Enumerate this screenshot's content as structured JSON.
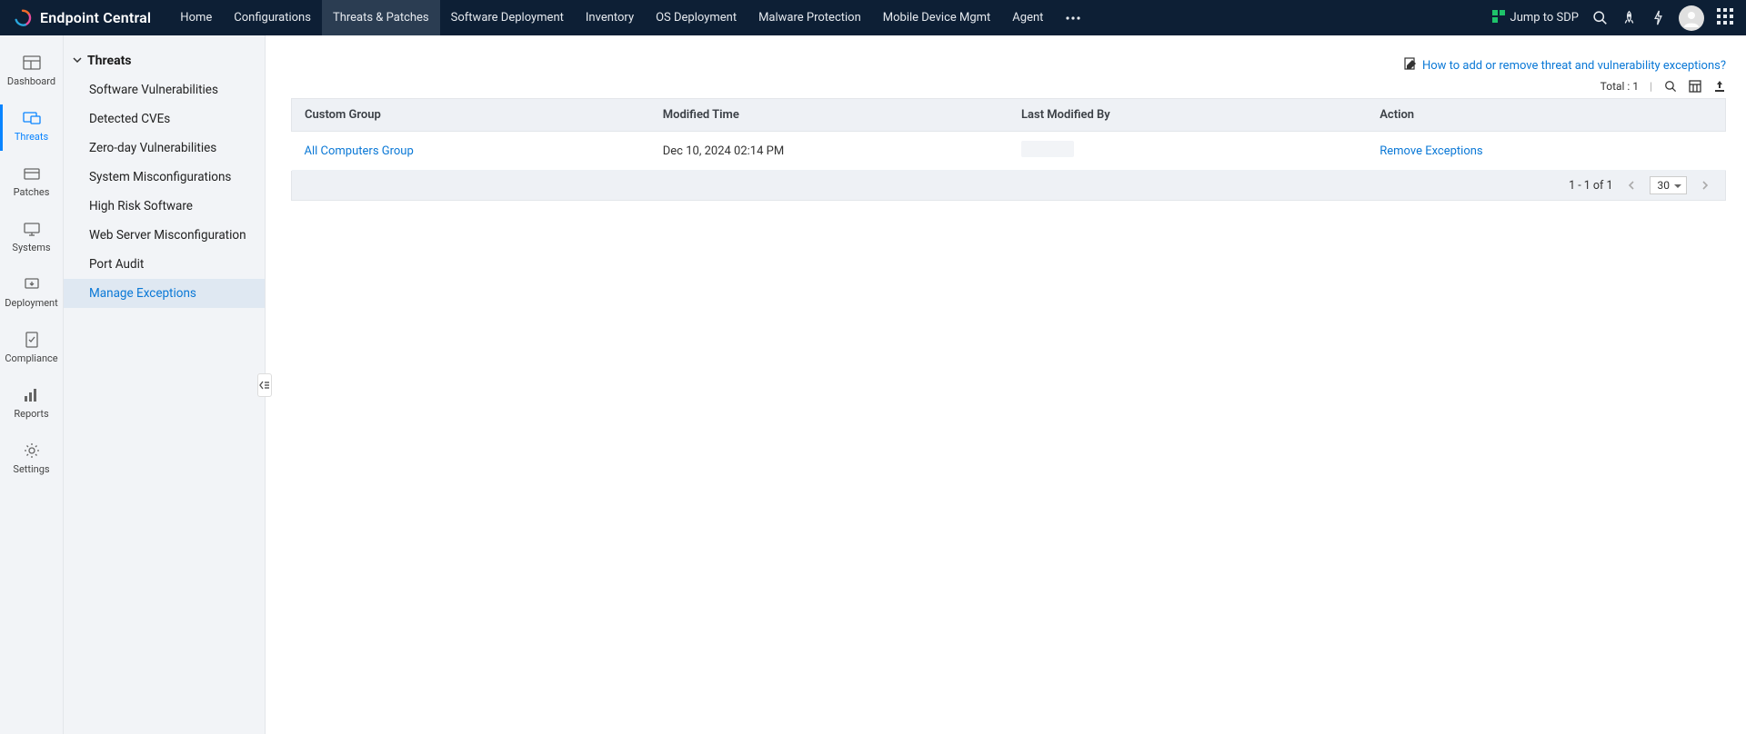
{
  "brand": "Endpoint Central",
  "main_menu": [
    {
      "label": "Home",
      "active": false
    },
    {
      "label": "Configurations",
      "active": false
    },
    {
      "label": "Threats & Patches",
      "active": true
    },
    {
      "label": "Software Deployment",
      "active": false
    },
    {
      "label": "Inventory",
      "active": false
    },
    {
      "label": "OS Deployment",
      "active": false
    },
    {
      "label": "Malware Protection",
      "active": false
    },
    {
      "label": "Mobile Device Mgmt",
      "active": false
    },
    {
      "label": "Agent",
      "active": false
    }
  ],
  "jump_to_sdp": "Jump to SDP",
  "left_rail": [
    {
      "label": "Dashboard",
      "icon": "dashboard",
      "active": false
    },
    {
      "label": "Threats",
      "icon": "threats",
      "active": true
    },
    {
      "label": "Patches",
      "icon": "patches",
      "active": false
    },
    {
      "label": "Systems",
      "icon": "systems",
      "active": false
    },
    {
      "label": "Deployment",
      "icon": "deployment",
      "active": false
    },
    {
      "label": "Compliance",
      "icon": "compliance",
      "active": false
    },
    {
      "label": "Reports",
      "icon": "reports",
      "active": false
    },
    {
      "label": "Settings",
      "icon": "settings",
      "active": false
    }
  ],
  "side_panel": {
    "group": "Threats",
    "items": [
      {
        "label": "Software Vulnerabilities",
        "selected": false
      },
      {
        "label": "Detected CVEs",
        "selected": false
      },
      {
        "label": "Zero-day Vulnerabilities",
        "selected": false
      },
      {
        "label": "System Misconfigurations",
        "selected": false
      },
      {
        "label": "High Risk Software",
        "selected": false
      },
      {
        "label": "Web Server Misconfiguration",
        "selected": false
      },
      {
        "label": "Port Audit",
        "selected": false
      },
      {
        "label": "Manage Exceptions",
        "selected": true
      }
    ]
  },
  "help_link": "How to add or remove threat and vulnerability exceptions?",
  "total_label": "Total : 1",
  "table": {
    "headers": [
      "Custom Group",
      "Modified Time",
      "Last Modified By",
      "Action"
    ],
    "rows": [
      {
        "group": "All Computers Group",
        "modified": "Dec 10, 2024 02:14 PM",
        "by": "",
        "action": "Remove Exceptions"
      }
    ]
  },
  "pagination": {
    "range": "1 - 1 of 1",
    "page_size": "30"
  }
}
